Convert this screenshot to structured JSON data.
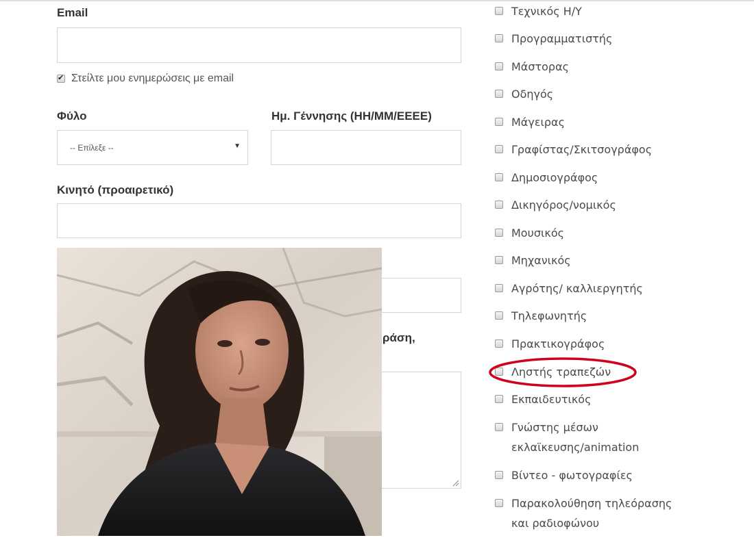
{
  "form": {
    "email_label": "Email",
    "email_value": "",
    "newsletter_label": "Στείλτε μου ενημερώσεις με email",
    "newsletter_checked": true,
    "gender_label": "Φύλο",
    "gender_selected": "-- Επίλεξε --",
    "birthdate_label": "Ημ. Γέννησης (ΗΗ/ΜΜ/ΕΕΕΕ)",
    "birthdate_value": "",
    "mobile_label": "Κινητό (προαιρετικό)",
    "mobile_value": "",
    "partial_label_fragment": "ράση,"
  },
  "occupations": [
    {
      "label": "Τεχνικός Η/Υ"
    },
    {
      "label": "Προγραμματιστής"
    },
    {
      "label": "Μάστορας"
    },
    {
      "label": "Οδηγός"
    },
    {
      "label": "Μάγειρας"
    },
    {
      "label": "Γραφίστας/Σκιτσογράφος"
    },
    {
      "label": "Δημοσιογράφος"
    },
    {
      "label": "Δικηγόρος/νομικός"
    },
    {
      "label": "Μουσικός"
    },
    {
      "label": "Μηχανικός"
    },
    {
      "label": "Αγρότης/ καλλιεργητής"
    },
    {
      "label": "Τηλεφωνητής"
    },
    {
      "label": "Πρακτικογράφος"
    },
    {
      "label": "Ληστής τραπεζών"
    },
    {
      "label": "Εκπαιδευτικός"
    },
    {
      "label": "Γνώστης μέσων\nεκλαϊκευσης/animation"
    },
    {
      "label": "Βίντεο - φωτογραφίες"
    },
    {
      "label": "Παρακολούθηση τηλεόρασης\nκαι ραδιοφώνου"
    }
  ],
  "colors": {
    "highlight_ellipse": "#d0021b",
    "field_border": "#d4d4d4"
  },
  "icons": {
    "select_caret": "▼"
  }
}
